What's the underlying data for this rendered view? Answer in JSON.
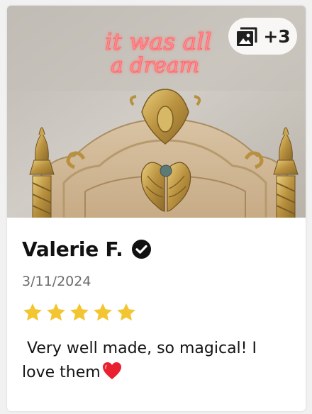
{
  "photo": {
    "neon_line1": "it was all",
    "neon_line2": "a dream",
    "extra_count": "+3",
    "icon": "gallery-icon"
  },
  "review": {
    "name": "Valerie F.",
    "verified_icon": "check-circle-icon",
    "date": "3/11/2024",
    "rating": 5,
    "rating_max": 5,
    "text": " Very well made, so magical! I love them",
    "emoji_icon": "red-heart-icon"
  },
  "colors": {
    "star": "#f2c531",
    "name": "#111111",
    "date": "#6b6b6b",
    "neon": "#ff6f73",
    "heart": "#e8202f"
  }
}
